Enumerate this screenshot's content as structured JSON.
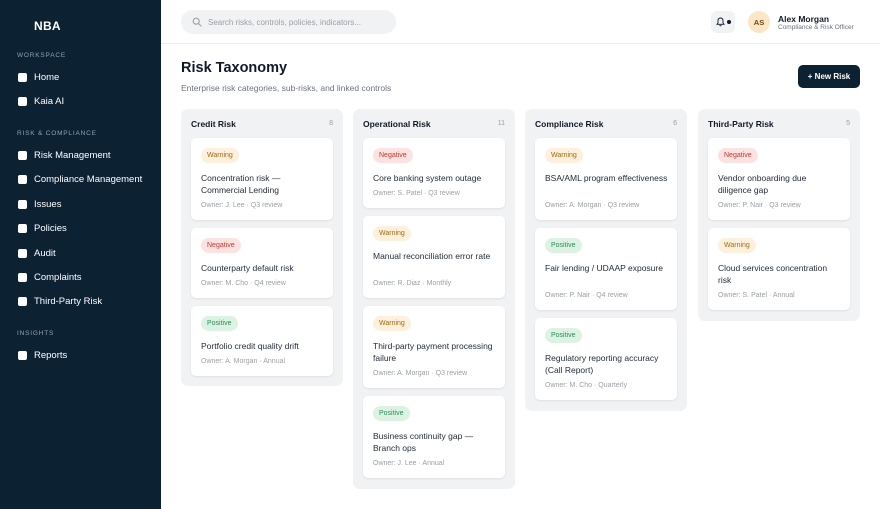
{
  "brand": "NBA",
  "sidebar": {
    "sections": [
      {
        "label": "WORKSPACE",
        "items": [
          "Home",
          "Kaia AI"
        ]
      },
      {
        "label": "RISK & COMPLIANCE",
        "items": [
          "Risk Management",
          "Compliance Management",
          "Issues",
          "Policies",
          "Audit",
          "Complaints",
          "Third-Party Risk"
        ]
      },
      {
        "label": "INSIGHTS",
        "items": [
          "Reports"
        ]
      }
    ]
  },
  "header": {
    "search_placeholder": "Search risks, controls, policies, indicators...",
    "user": {
      "initials": "AS",
      "name": "Alex Morgan",
      "role": "Compliance & Risk Officer"
    }
  },
  "page": {
    "title": "Risk Taxonomy",
    "subtitle": "Enterprise risk categories, sub-risks, and linked controls",
    "new_button": "+ New Risk"
  },
  "colors": {
    "sidebar": "#0c2233",
    "primary": "#0c2233",
    "warning": "#a56a14",
    "negative": "#c0392b",
    "positive": "#2e8b57"
  },
  "columns": [
    {
      "title": "Credit Risk",
      "count": "8",
      "cards": [
        {
          "status": "warning",
          "badge": "Warning",
          "title": "Concentration risk — Commercial Lending",
          "meta": "Owner: J. Lee · Q3 review"
        },
        {
          "status": "negative",
          "badge": "Negative",
          "title": "Counterparty default risk",
          "meta": "Owner: M. Cho · Q4 review"
        },
        {
          "status": "positive",
          "badge": "Positive",
          "title": "Portfolio credit quality drift",
          "meta": "Owner: A. Morgan · Annual"
        }
      ]
    },
    {
      "title": "Operational Risk",
      "count": "11",
      "cards": [
        {
          "status": "negative",
          "badge": "Negative",
          "title": "Core banking system outage",
          "meta": "Owner: S. Patel · Q3 review"
        },
        {
          "status": "warning",
          "badge": "Warning",
          "title": "Manual reconciliation error rate",
          "meta": "Owner: R. Diaz · Monthly"
        },
        {
          "status": "warning",
          "badge": "Warning",
          "title": "Third-party payment processing failure",
          "meta": "Owner: A. Morgan · Q3 review"
        },
        {
          "status": "positive",
          "badge": "Positive",
          "title": "Business continuity gap — Branch ops",
          "meta": "Owner: J. Lee · Annual"
        }
      ]
    },
    {
      "title": "Compliance Risk",
      "count": "6",
      "cards": [
        {
          "status": "warning",
          "badge": "Warning",
          "title": "BSA/AML program effectiveness",
          "meta": "Owner: A. Morgan · Q3 review"
        },
        {
          "status": "positive",
          "badge": "Positive",
          "title": "Fair lending / UDAAP exposure",
          "meta": "Owner: P. Nair · Q4 review"
        },
        {
          "status": "positive",
          "badge": "Positive",
          "title": "Regulatory reporting accuracy (Call Report)",
          "meta": "Owner: M. Cho · Quarterly"
        }
      ]
    },
    {
      "title": "Third-Party Risk",
      "count": "5",
      "cards": [
        {
          "status": "negative",
          "badge": "Negative",
          "title": "Vendor onboarding due diligence gap",
          "meta": "Owner: P. Nair · Q3 review"
        },
        {
          "status": "warning",
          "badge": "Warning",
          "title": "Cloud services concentration risk",
          "meta": "Owner: S. Patel · Annual"
        }
      ]
    }
  ]
}
